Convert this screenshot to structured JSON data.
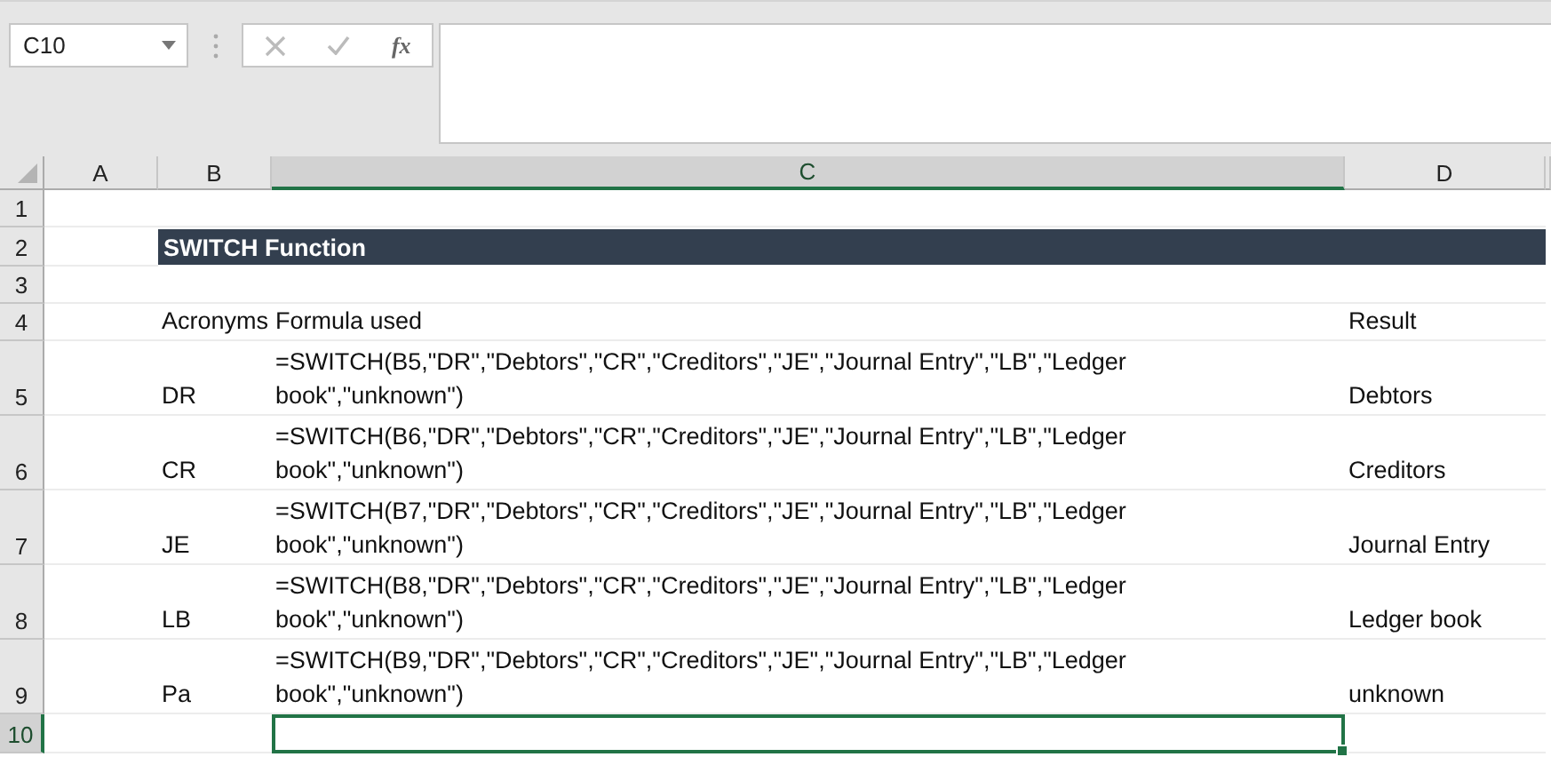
{
  "name_box": {
    "value": "C10"
  },
  "formula_bar": {
    "function_label": "fx"
  },
  "columns": [
    {
      "label": "A",
      "selected": false
    },
    {
      "label": "B",
      "selected": false
    },
    {
      "label": "C",
      "selected": true
    },
    {
      "label": "D",
      "selected": false
    }
  ],
  "rows": [
    {
      "number": "1",
      "selected": false,
      "kind": "blank"
    },
    {
      "number": "2",
      "selected": false,
      "kind": "title",
      "title": "SWITCH Function"
    },
    {
      "number": "3",
      "selected": false,
      "kind": "blank"
    },
    {
      "number": "4",
      "selected": false,
      "kind": "data",
      "cells": [
        "Acronyms",
        "Formula used",
        "Result"
      ]
    },
    {
      "number": "5",
      "selected": false,
      "kind": "data",
      "cells": [
        "DR",
        "=SWITCH(B5,\"DR\",\"Debtors\",\"CR\",\"Creditors\",\"JE\",\"Journal Entry\",\"LB\",\"Ledger book\",\"unknown\")",
        "Debtors"
      ]
    },
    {
      "number": "6",
      "selected": false,
      "kind": "data",
      "cells": [
        "CR",
        "=SWITCH(B6,\"DR\",\"Debtors\",\"CR\",\"Creditors\",\"JE\",\"Journal Entry\",\"LB\",\"Ledger book\",\"unknown\")",
        "Creditors"
      ]
    },
    {
      "number": "7",
      "selected": false,
      "kind": "data",
      "cells": [
        "JE",
        "=SWITCH(B7,\"DR\",\"Debtors\",\"CR\",\"Creditors\",\"JE\",\"Journal Entry\",\"LB\",\"Ledger book\",\"unknown\")",
        "Journal Entry"
      ]
    },
    {
      "number": "8",
      "selected": false,
      "kind": "data",
      "cells": [
        "LB",
        "=SWITCH(B8,\"DR\",\"Debtors\",\"CR\",\"Creditors\",\"JE\",\"Journal Entry\",\"LB\",\"Ledger book\",\"unknown\")",
        "Ledger book"
      ]
    },
    {
      "number": "9",
      "selected": false,
      "kind": "data",
      "cells": [
        "Pa",
        "=SWITCH(B9,\"DR\",\"Debtors\",\"CR\",\"Creditors\",\"JE\",\"Journal Entry\",\"LB\",\"Ledger book\",\"unknown\")",
        "unknown"
      ]
    },
    {
      "number": "10",
      "selected": true,
      "kind": "data",
      "cells": [
        "",
        "",
        ""
      ]
    }
  ]
}
